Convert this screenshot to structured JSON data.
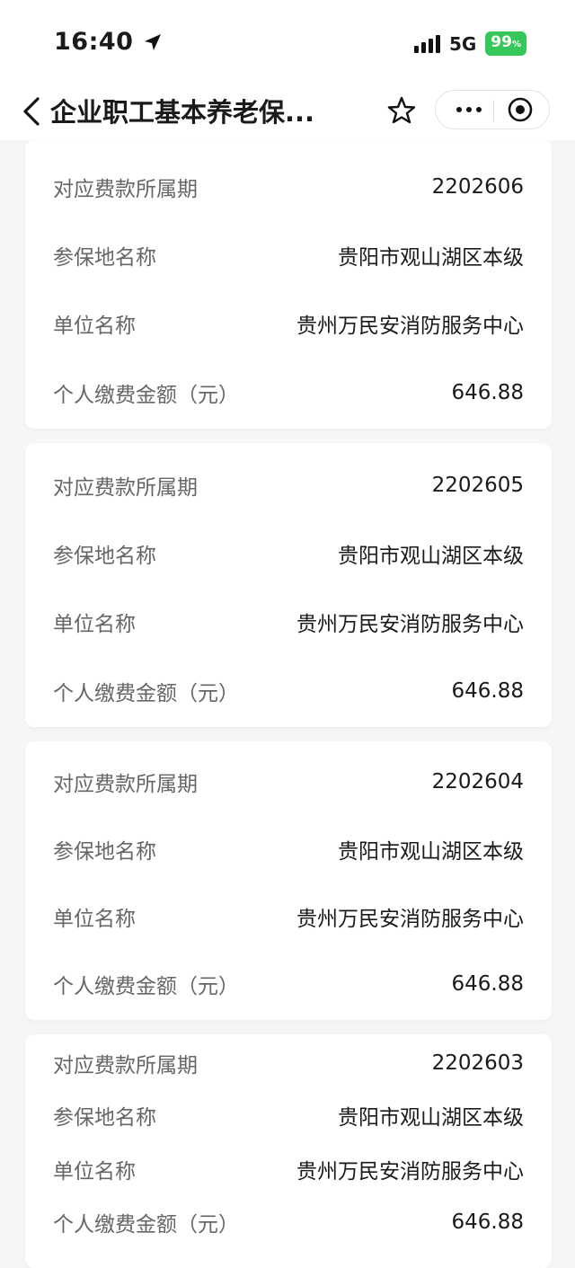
{
  "status_bar": {
    "time": "16:40",
    "network": "5G",
    "battery": "99",
    "battery_unit": "%"
  },
  "nav": {
    "title": "企业职工基本养老保...",
    "icons": [
      "back-icon",
      "star-icon",
      "more-icon",
      "record-icon"
    ]
  },
  "records": [
    {
      "period_label": "对应费款所属期",
      "period": "2202606",
      "region_label": "参保地名称",
      "region": "贵阳市观山湖区本级",
      "unit_label": "单位名称",
      "unit": "贵州万民安消防服务中心",
      "amount_label": "个人缴费金额（元）",
      "amount": "646.88"
    },
    {
      "period_label": "对应费款所属期",
      "period": "2202605",
      "region_label": "参保地名称",
      "region": "贵阳市观山湖区本级",
      "unit_label": "单位名称",
      "unit": "贵州万民安消防服务中心",
      "amount_label": "个人缴费金额（元）",
      "amount": "646.88"
    },
    {
      "period_label": "对应费款所属期",
      "period": "2202604",
      "region_label": "参保地名称",
      "region": "贵阳市观山湖区本级",
      "unit_label": "单位名称",
      "unit": "贵州万民安消防服务中心",
      "amount_label": "个人缴费金额（元）",
      "amount": "646.88"
    },
    {
      "period_label": "对应费款所属期",
      "period": "2202603",
      "region_label": "参保地名称",
      "region": "贵阳市观山湖区本级",
      "unit_label": "单位名称",
      "unit": "贵州万民安消防服务中心",
      "amount_label": "个人缴费金额（元）",
      "amount": "646.88"
    }
  ],
  "colors": {
    "battery": "#35c759",
    "background": "#f5f6f8",
    "label": "#666666",
    "value": "#1a1a1a"
  }
}
